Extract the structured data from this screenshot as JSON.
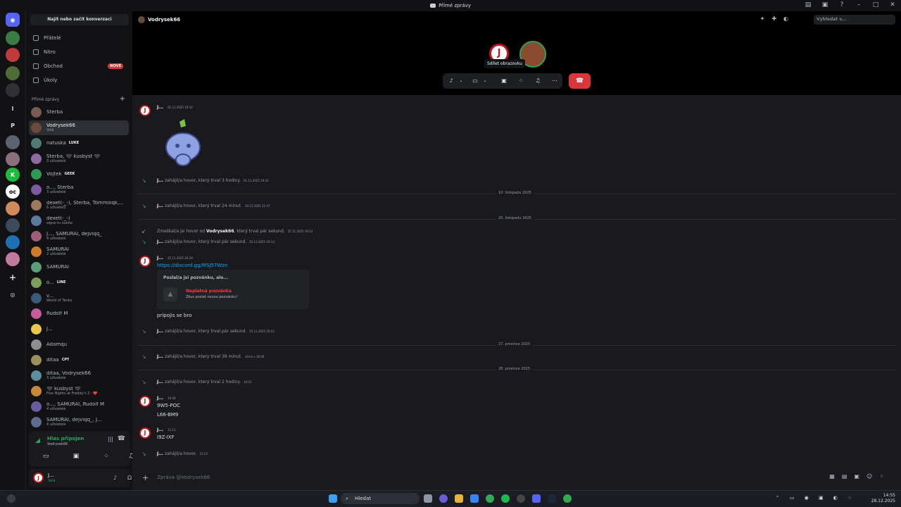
{
  "window": {
    "title": "Přímé zprávy"
  },
  "sidebar": {
    "search_button": "Najít nebo začít konverzaci",
    "nav": [
      {
        "label": "Přátelé"
      },
      {
        "label": "Nitro"
      },
      {
        "label": "Obchod",
        "badge": "NOVÉ"
      },
      {
        "label": "Úkoly"
      }
    ],
    "section_title": "Přímé zprávy",
    "dms": [
      {
        "name": "Sterba",
        "sub": ""
      },
      {
        "name": "Vodrysek66",
        "sub": "Volá"
      },
      {
        "name": "natuska",
        "sub": "",
        "tag": "LUKE"
      },
      {
        "name": "Sterba, 🖤 kusbyst 🖤",
        "sub": "3 uživatelé"
      },
      {
        "name": "Vojtek",
        "sub": "",
        "tag": "GEEK"
      },
      {
        "name": "o..., Sterba",
        "sub": "3 uživatelé"
      },
      {
        "name": "dexet(-_-), Sterba, Tommiiiqk,...",
        "sub": "6 uživatelů"
      },
      {
        "name": "dexet(-_-)",
        "sub": "sigue tu sueño"
      },
      {
        "name": "J..., SAMURAI, dejviqq_",
        "sub": "4 uživatelé"
      },
      {
        "name": "SAMURAI",
        "sub": "2 uživatelé"
      },
      {
        "name": "SAMURAI",
        "sub": ""
      },
      {
        "name": "o...",
        "sub": "",
        "tag": "LINE"
      },
      {
        "name": "v...",
        "sub": "World of Tanks"
      },
      {
        "name": "Rudolf M",
        "sub": ""
      },
      {
        "name": "J...",
        "sub": ""
      },
      {
        "name": "Adamqu",
        "sub": ""
      },
      {
        "name": "ditaa",
        "sub": "",
        "tag": "CPT"
      },
      {
        "name": "ditaa, Vodrysek66",
        "sub": "3 uživatelé"
      },
      {
        "name": "🖤 kusbyst 🖤",
        "sub": "Five Nights at Freddy's 2 - ❤️"
      },
      {
        "name": "o..., SAMURAI, Rudolf M",
        "sub": "4 uživatelé"
      },
      {
        "name": "SAMURAI, dejviqq_, J...",
        "sub": "4 uživatelé"
      }
    ],
    "voice_panel": {
      "title": "Hlas připojen",
      "subtitle": "Vodrysek66"
    },
    "user_panel": {
      "name": "J...",
      "status": "Volá"
    }
  },
  "header": {
    "title": "Vodrysek66",
    "search_placeholder": "Vyhledat v..."
  },
  "call": {
    "tooltip": "Sdílet obrazovku"
  },
  "messages": {
    "m1": {
      "author": "J...",
      "time": "01.11.2025 19:32"
    },
    "call1": {
      "author": "J...",
      "text": "zahájil/a hovor, který trval 3 hodiny.",
      "time": "01.11.2025 19:32"
    },
    "divider1": "10. listopadu 2025",
    "call2": {
      "author": "J...",
      "text": "zahájil/a hovor, který trval 24 minut.",
      "time": "10.11.2025 21:47"
    },
    "divider2": "25. listopadu 2025",
    "missed": {
      "prefix": "Zmeškal/a jsi hovor od",
      "who": "Vodrysek66",
      "suffix": ", který trval pár sekund.",
      "time": "25.11.2025 19:12"
    },
    "call3": {
      "author": "J...",
      "text": "zahájil/a hovor, který trval pár sekund.",
      "time": "25.11.2025 19:13"
    },
    "m2": {
      "author": "J...",
      "time": "25.11.2025 20:19",
      "link": "https://discord.gg/MSJ57Wzn",
      "invite_title": "Poslal/a jsi pozvánku, ale...",
      "invite_err": "Neplatná pozvánka",
      "invite_hint": "Zkus poslat novou pozvánku!",
      "text": "pripojis se bro"
    },
    "call4": {
      "author": "J...",
      "text": "zahájil/a hovor, který trval pár sekund.",
      "time": "25.11.2025 20:22"
    },
    "divider3": "27. prosince 2025",
    "call5": {
      "author": "J...",
      "text": "zahájil/a hovor, který trval 39 minut.",
      "time": "včera v 18:06"
    },
    "divider4": "28. prosince 2025",
    "call6": {
      "author": "J...",
      "text": "zahájil/a hovor, který trval 2 hodiny.",
      "time": "10:23"
    },
    "m3": {
      "author": "J...",
      "time": "10:44",
      "line1": "9W5-POC",
      "line2": "L66-BM9"
    },
    "m4": {
      "author": "J...",
      "time": "11:11",
      "line1": "I9Z-IXF"
    },
    "call7": {
      "author": "J...",
      "text": "zahájil/a hovor.",
      "time": "12:23"
    }
  },
  "composer": {
    "placeholder": "Zpráva @Vodrysek66"
  },
  "taskbar": {
    "search": "Hledat",
    "time": "14:55",
    "date": "28.12.2025"
  }
}
